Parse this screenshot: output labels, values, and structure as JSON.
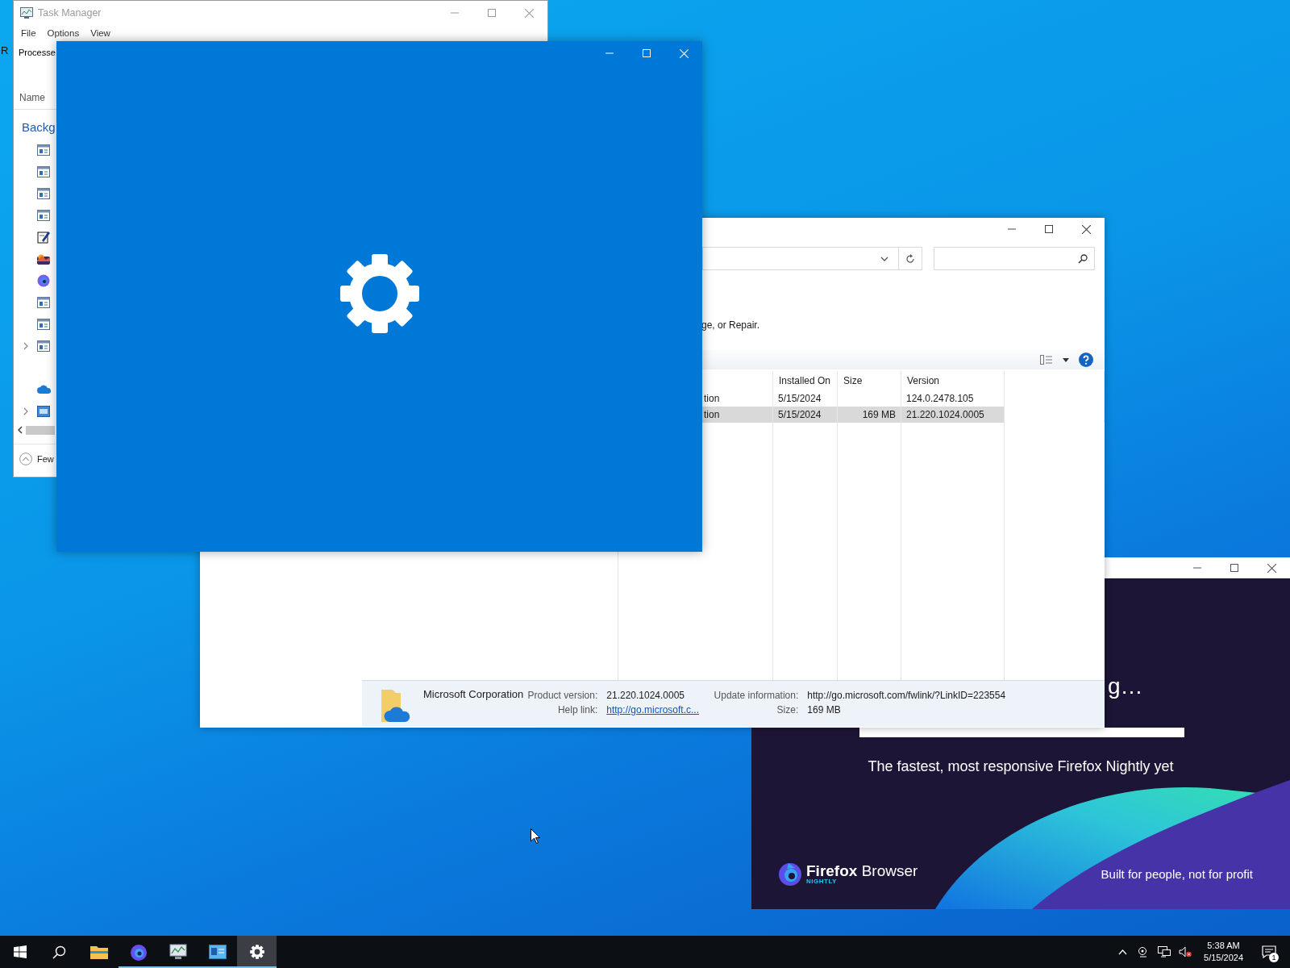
{
  "desktop": {
    "icon_label": "R"
  },
  "task_manager": {
    "title": "Task Manager",
    "menu": [
      "File",
      "Options",
      "View"
    ],
    "tab": "Processe",
    "column": "Name",
    "group": "Backg",
    "processes": [
      {
        "kind": "window",
        "expandable": false
      },
      {
        "kind": "window",
        "expandable": false
      },
      {
        "kind": "window",
        "expandable": false
      },
      {
        "kind": "window",
        "expandable": false
      },
      {
        "kind": "notepad",
        "expandable": false
      },
      {
        "kind": "photos",
        "expandable": false
      },
      {
        "kind": "firefox",
        "expandable": false
      },
      {
        "kind": "window",
        "expandable": false
      },
      {
        "kind": "window",
        "expandable": false
      },
      {
        "kind": "window",
        "expandable": true
      },
      {
        "kind": "none"
      },
      {
        "kind": "onedrive",
        "expandable": false
      },
      {
        "kind": "monitor",
        "expandable": true
      }
    ],
    "footer": "Few"
  },
  "programs_window": {
    "instruction": "ge, or Repair.",
    "columns": [
      "Installed On",
      "Size",
      "Version"
    ],
    "rows": [
      {
        "name": "tion",
        "installed_on": "5/15/2024",
        "version": "124.0.2478.105",
        "selected": false
      },
      {
        "name": "tion",
        "installed_on": "5/15/2024",
        "size": "169 MB",
        "version": "21.220.1024.0005",
        "selected": true
      }
    ],
    "details": {
      "publisher": "Microsoft Corporation",
      "fields": [
        {
          "label": "Product version:",
          "value": "21.220.1024.0005",
          "kind": "text"
        },
        {
          "label": "Update information:",
          "value": "http://go.microsoft.com/fwlink/?LinkID=223554",
          "kind": "text"
        },
        {
          "label": "Help link:",
          "value": "http://go.microsoft.c...",
          "kind": "link"
        },
        {
          "label": "Size:",
          "value": "169 MB",
          "kind": "text"
        }
      ]
    }
  },
  "firefox_window": {
    "heading": "g…",
    "progress": {
      "level": 1
    },
    "tagline": "The fastest, most responsive Firefox Nightly yet",
    "logo": {
      "brand": "Firefox",
      "product": "Browser",
      "edition": "NIGHTLY"
    },
    "slogan": "Built for people, not for profit"
  },
  "taskbar": {
    "buttons": [
      {
        "kind": "start",
        "running": false,
        "selected": false
      },
      {
        "kind": "search",
        "running": false,
        "selected": false
      },
      {
        "kind": "explorer",
        "running": false,
        "selected": false
      },
      {
        "kind": "firefox",
        "running": true,
        "selected": false
      },
      {
        "kind": "taskmanager",
        "running": true,
        "selected": false
      },
      {
        "kind": "controlpanel",
        "running": true,
        "selected": false
      },
      {
        "kind": "settings",
        "running": true,
        "selected": true
      }
    ],
    "tray": {
      "time": "5:38 AM",
      "date": "5/15/2024",
      "notifications": "1"
    }
  }
}
